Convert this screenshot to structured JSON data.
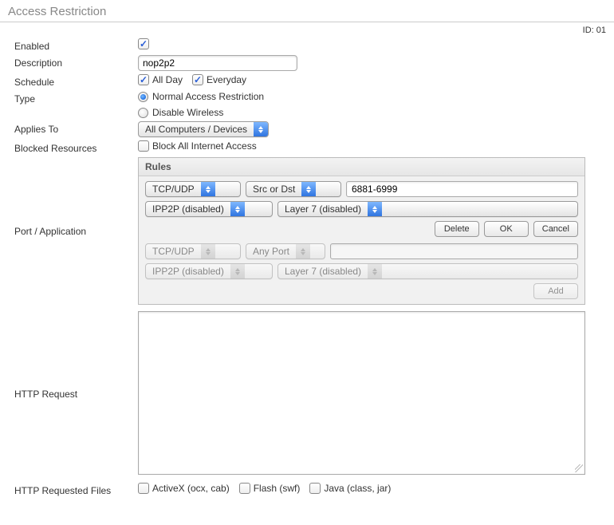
{
  "page_title": "Access Restriction",
  "id_label": "ID: 01",
  "labels": {
    "enabled": "Enabled",
    "description": "Description",
    "schedule": "Schedule",
    "type": "Type",
    "applies_to": "Applies To",
    "blocked": "Blocked Resources",
    "port_app": "Port / Application",
    "http_request": "HTTP Request",
    "http_files": "HTTP Requested Files"
  },
  "values": {
    "description": "nop2p2",
    "schedule_allday": "All Day",
    "schedule_everyday": "Everyday",
    "type_normal": "Normal Access Restriction",
    "type_disable_wireless": "Disable Wireless",
    "applies_to": "All Computers / Devices",
    "block_all_label": "Block All Internet Access"
  },
  "rules": {
    "header": "Rules",
    "row1": {
      "proto": "TCP/UDP",
      "dir": "Src or Dst",
      "ports": "6881-6999",
      "ipp2p": "IPP2P (disabled)",
      "layer7": "Layer 7 (disabled)"
    },
    "row2": {
      "proto": "TCP/UDP",
      "dir": "Any Port",
      "ports": "",
      "ipp2p": "IPP2P (disabled)",
      "layer7": "Layer 7 (disabled)"
    },
    "buttons": {
      "delete": "Delete",
      "ok": "OK",
      "cancel": "Cancel",
      "add": "Add"
    }
  },
  "http_files": {
    "activex": "ActiveX (ocx, cab)",
    "flash": "Flash (swf)",
    "java": "Java (class, jar)"
  }
}
